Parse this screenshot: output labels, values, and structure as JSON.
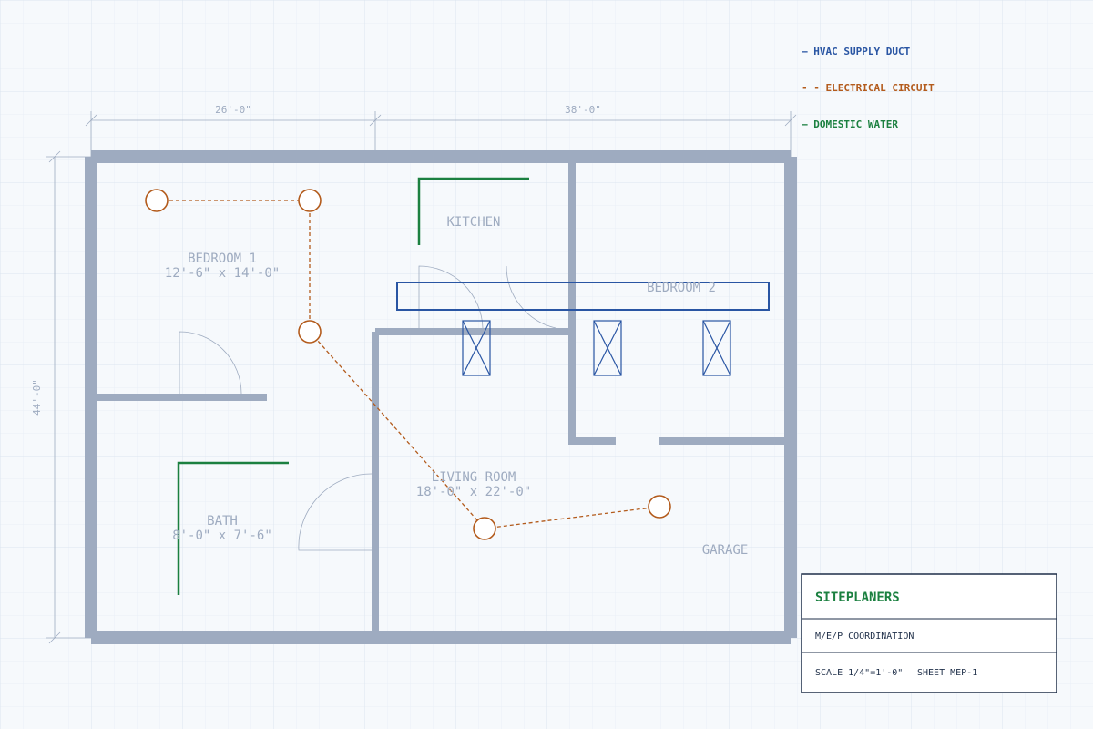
{
  "legend": {
    "hvac": "— HVAC SUPPLY DUCT",
    "electrical": "- - ELECTRICAL CIRCUIT",
    "water": "— DOMESTIC WATER",
    "hvac_color": "#2955a3",
    "electrical_color": "#b35b1c",
    "water_color": "#1b8040"
  },
  "dimensions": {
    "top_left": "26'-0\"",
    "top_right": "38'-0\"",
    "left": "44'-0\""
  },
  "rooms": {
    "bedroom1": {
      "name": "BEDROOM 1",
      "size": "12'-6\" x 14'-0\""
    },
    "kitchen": {
      "name": "KITCHEN"
    },
    "bedroom2": {
      "name": "BEDROOM 2"
    },
    "bath": {
      "name": "BATH",
      "size": "8'-0\" x 7'-6\""
    },
    "living": {
      "name": "LIVING ROOM",
      "size": "18'-0\" x 22'-0\""
    },
    "garage": {
      "name": "GARAGE"
    }
  },
  "title_block": {
    "company": "SITEPLANERS",
    "project": "M/E/P COORDINATION",
    "scale": "SCALE 1/4\"=1'-0\"",
    "sheet": "SHEET MEP-1"
  },
  "colors": {
    "wall": "#9eabc0",
    "background": "#f6f9fc",
    "title_block_border": "#1f2f49"
  }
}
